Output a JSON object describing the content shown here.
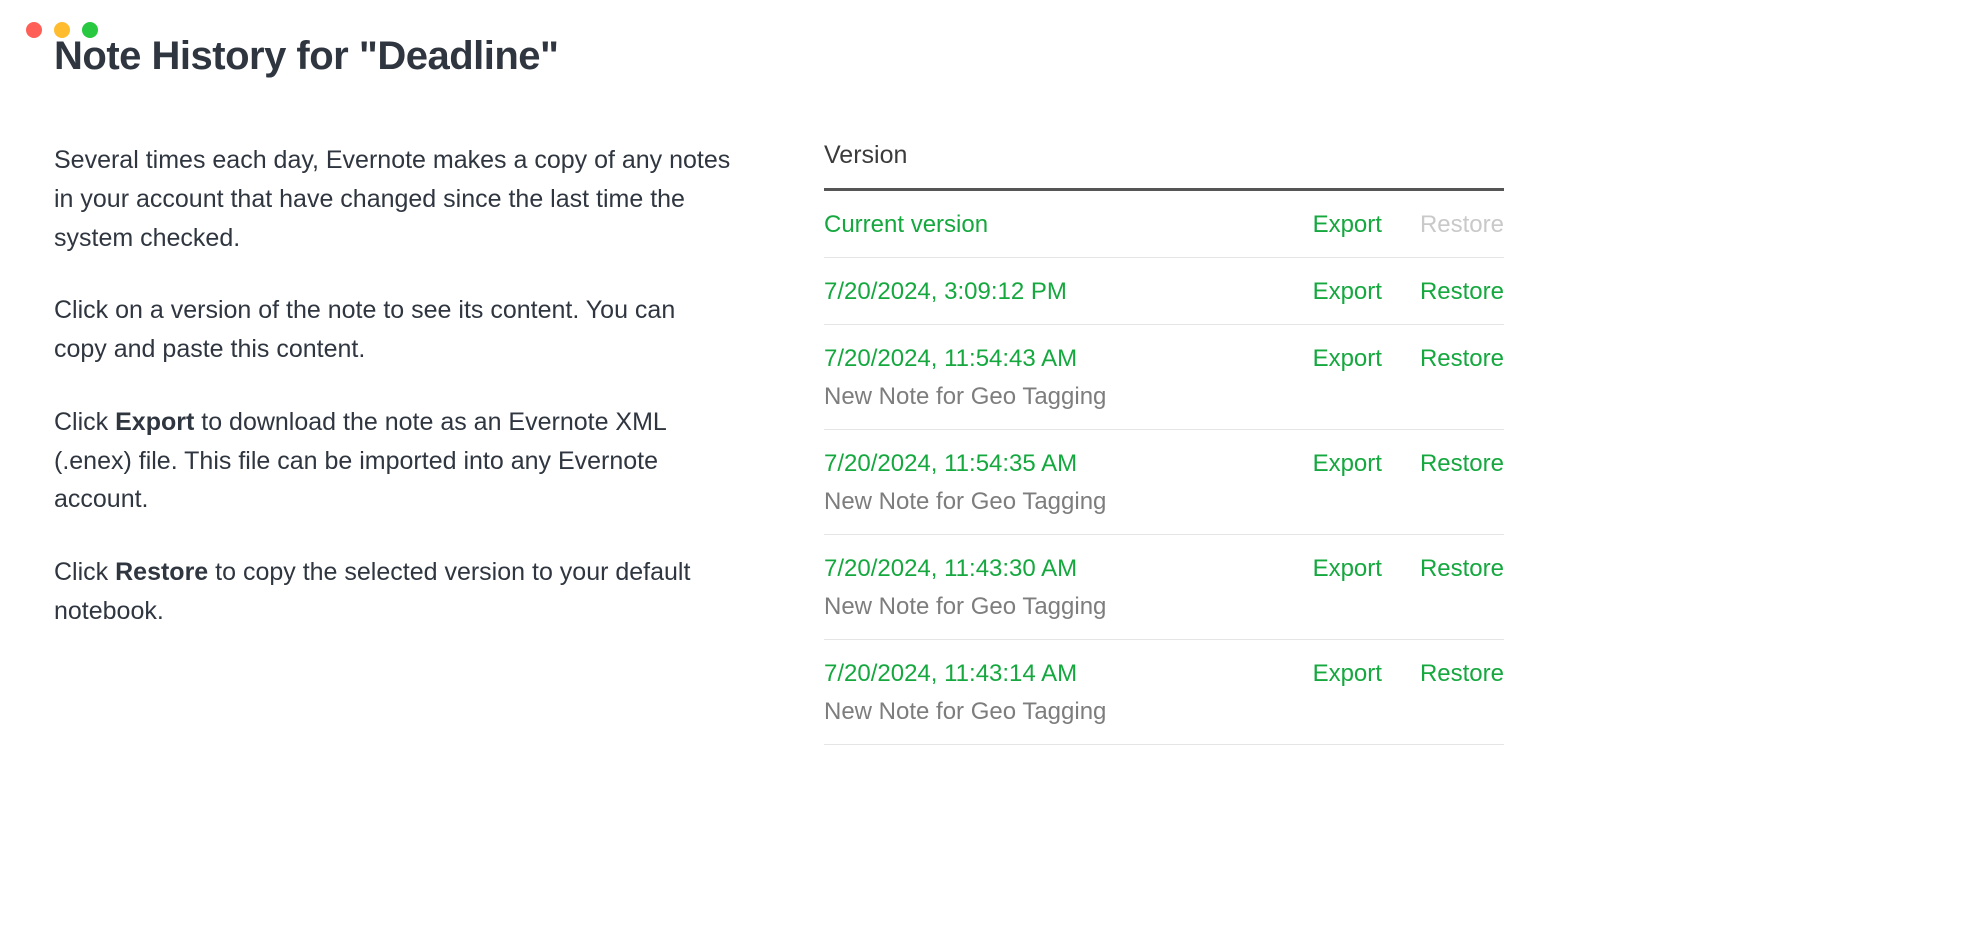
{
  "page_title": "Note History for \"Deadline\"",
  "description": {
    "p1": "Several times each day, Evernote makes a copy of any notes in your account that have changed since the last time the system checked.",
    "p2": "Click on a version of the note to see its content. You can copy and paste this content.",
    "p3_pre": "Click ",
    "p3_bold": "Export",
    "p3_post": " to download the note as an Evernote XML (.enex) file. This file can be imported into any Evernote account.",
    "p4_pre": "Click ",
    "p4_bold": "Restore",
    "p4_post": " to copy the selected version to your default notebook."
  },
  "table_header": "Version",
  "export_label": "Export",
  "restore_label": "Restore",
  "versions": [
    {
      "label": "Current version",
      "subtitle": "",
      "restore_enabled": false
    },
    {
      "label": "7/20/2024, 3:09:12 PM",
      "subtitle": "",
      "restore_enabled": true
    },
    {
      "label": "7/20/2024, 11:54:43 AM",
      "subtitle": "New Note for Geo Tagging",
      "restore_enabled": true
    },
    {
      "label": "7/20/2024, 11:54:35 AM",
      "subtitle": "New Note for Geo Tagging",
      "restore_enabled": true
    },
    {
      "label": "7/20/2024, 11:43:30 AM",
      "subtitle": "New Note for Geo Tagging",
      "restore_enabled": true
    },
    {
      "label": "7/20/2024, 11:43:14 AM",
      "subtitle": "New Note for Geo Tagging",
      "restore_enabled": true
    }
  ]
}
